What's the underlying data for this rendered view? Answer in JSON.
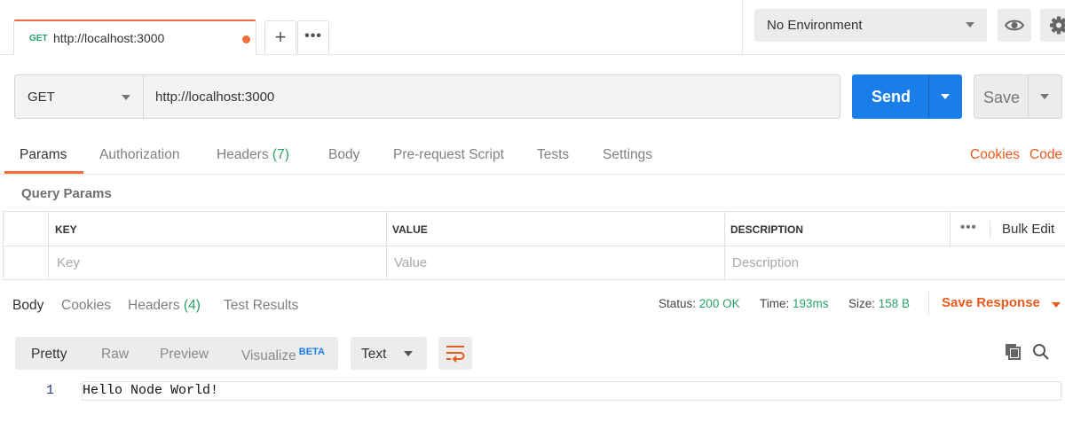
{
  "tabs": {
    "active_tab": {
      "method": "GET",
      "title": "http://localhost:3000",
      "unsaved": true
    },
    "new_tab_label": "+",
    "more_label": "•••"
  },
  "environment": {
    "selected": "No Environment",
    "icons": [
      "eye-icon",
      "gear-icon"
    ]
  },
  "request": {
    "method": "GET",
    "url": "http://localhost:3000",
    "send_label": "Send",
    "save_label": "Save"
  },
  "request_tabs": {
    "items": [
      "Params",
      "Authorization",
      "Headers",
      "Body",
      "Pre-request Script",
      "Tests",
      "Settings"
    ],
    "headers_count": "(7)",
    "active": "Params",
    "right_links": [
      "Cookies",
      "Code"
    ]
  },
  "query_params": {
    "title": "Query Params",
    "columns": [
      "KEY",
      "VALUE",
      "DESCRIPTION"
    ],
    "placeholders": [
      "Key",
      "Value",
      "Description"
    ],
    "more_label": "•••",
    "bulk_edit_label": "Bulk Edit"
  },
  "response": {
    "tabs": [
      "Body",
      "Cookies",
      "Headers",
      "Test Results"
    ],
    "headers_count": "(4)",
    "active": "Body",
    "status_label": "Status:",
    "status_value": "200 OK",
    "time_label": "Time:",
    "time_value": "193ms",
    "size_label": "Size:",
    "size_value": "158 B",
    "save_response_label": "Save Response",
    "format_options": [
      "Pretty",
      "Raw",
      "Preview",
      "Visualize"
    ],
    "beta_label": "BETA",
    "active_format": "Pretty",
    "text_type": "Text",
    "lines": [
      {
        "number": "1",
        "text": "Hello Node World!"
      }
    ]
  },
  "colors": {
    "accent": "#f26b3a",
    "send": "#1a7ee8",
    "success": "#26a269",
    "link": "#e85a1c"
  }
}
